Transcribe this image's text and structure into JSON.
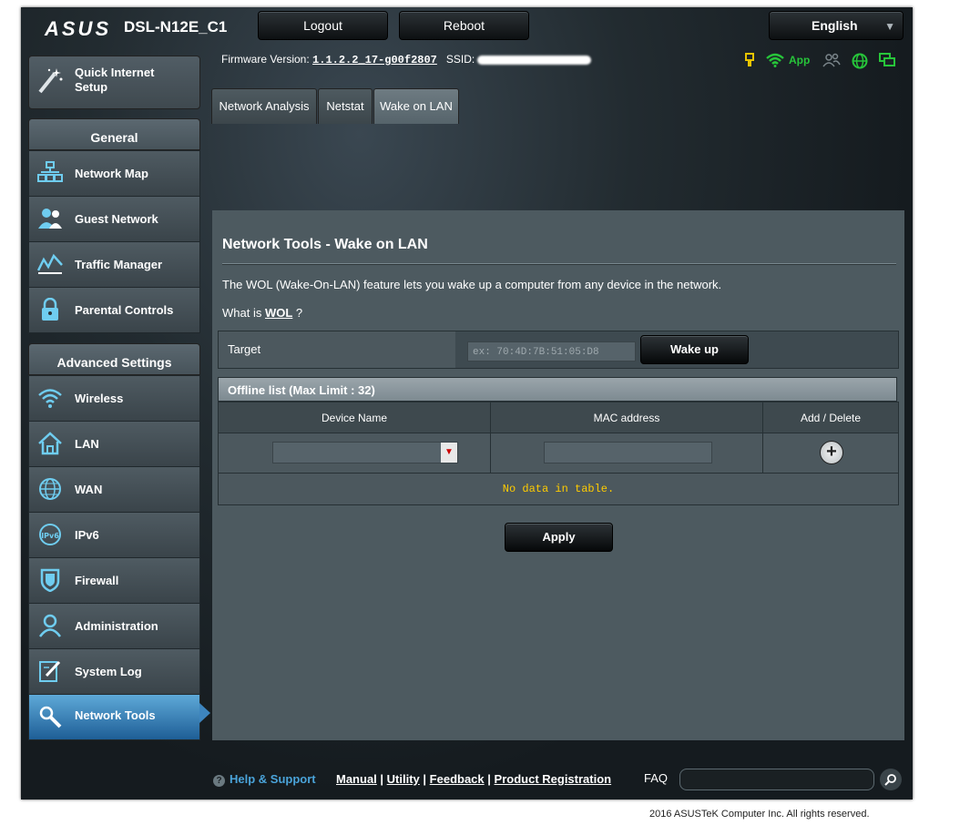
{
  "header": {
    "brand": "ASUS",
    "model": "DSL-N12E_C1",
    "logout_label": "Logout",
    "reboot_label": "Reboot",
    "language": "English"
  },
  "status": {
    "firmware_label": "Firmware Version:",
    "firmware_version": "1.1.2.2_17-g00f2807",
    "ssid_label": "SSID:",
    "app_label": "App",
    "icons": [
      "usb-icon",
      "wifi-icon",
      "clients-icon",
      "internet-globe-icon",
      "display-icon"
    ]
  },
  "nav": {
    "quick_setup": "Quick Internet Setup",
    "general_header": "General",
    "general_items": [
      {
        "label": "Network Map",
        "icon": "network-map-icon"
      },
      {
        "label": "Guest Network",
        "icon": "guest-network-icon"
      },
      {
        "label": "Traffic Manager",
        "icon": "traffic-manager-icon"
      },
      {
        "label": "Parental Controls",
        "icon": "parental-controls-icon"
      }
    ],
    "advanced_header": "Advanced Settings",
    "advanced_items": [
      {
        "label": "Wireless",
        "icon": "wireless-icon"
      },
      {
        "label": "LAN",
        "icon": "lan-icon"
      },
      {
        "label": "WAN",
        "icon": "wan-icon"
      },
      {
        "label": "IPv6",
        "icon": "ipv6-icon"
      },
      {
        "label": "Firewall",
        "icon": "firewall-icon"
      },
      {
        "label": "Administration",
        "icon": "administration-icon"
      },
      {
        "label": "System Log",
        "icon": "system-log-icon"
      },
      {
        "label": "Network Tools",
        "icon": "network-tools-icon"
      }
    ],
    "active": "Network Tools"
  },
  "tabs": [
    {
      "label": "Network Analysis"
    },
    {
      "label": "Netstat"
    },
    {
      "label": "Wake on LAN"
    }
  ],
  "active_tab": "Wake on LAN",
  "page": {
    "title": "Network Tools - Wake on LAN",
    "description": "The WOL (Wake-On-LAN) feature lets you wake up a computer from any device in the network.",
    "whatis_prefix": "What is",
    "whatis_link": "WOL",
    "whatis_suffix": "?",
    "target_label": "Target",
    "target_placeholder": "ex: 70:4D:7B:51:05:D8",
    "wakeup_label": "Wake up",
    "offline_header": "Offline list (Max Limit : 32)",
    "col_device": "Device Name",
    "col_mac": "MAC address",
    "col_add": "Add / Delete",
    "no_data": "No data in table.",
    "apply_label": "Apply"
  },
  "footer": {
    "help": "Help & Support",
    "links": [
      "Manual",
      "Utility",
      "Feedback",
      "Product Registration"
    ],
    "faq": "FAQ",
    "copyright": "2016 ASUSTeK Computer Inc. All rights reserved."
  }
}
